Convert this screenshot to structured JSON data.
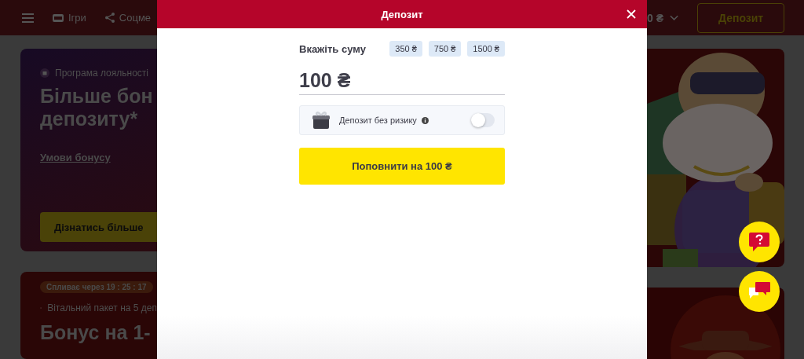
{
  "header": {
    "nav": [
      {
        "label": "Ігри"
      },
      {
        "label": "Соцме"
      }
    ],
    "balance": "0 ₴",
    "deposit_button": "Депозит"
  },
  "promo_cards": [
    {
      "tag": "Програма лояльності",
      "title_lines": [
        "Більше бон",
        "депозиту*"
      ],
      "link": "Умови бонусу",
      "button": "Дізнатись більше"
    },
    {
      "timer": "Спливає через 19 : 25 : 17",
      "tag": "Вітальний пакет на 5 деп",
      "title_lines": [
        "Бонус на 1-"
      ]
    }
  ],
  "modal": {
    "title": "Депозит",
    "amount_label": "Вкажіть суму",
    "presets": [
      {
        "label": "350 ₴"
      },
      {
        "label": "750 ₴"
      },
      {
        "label": "1500 ₴"
      }
    ],
    "amount": "100 ₴",
    "risk_free": {
      "label": "Депозит без ризику",
      "on": false
    },
    "submit": "Поповнити на 100 ₴"
  }
}
